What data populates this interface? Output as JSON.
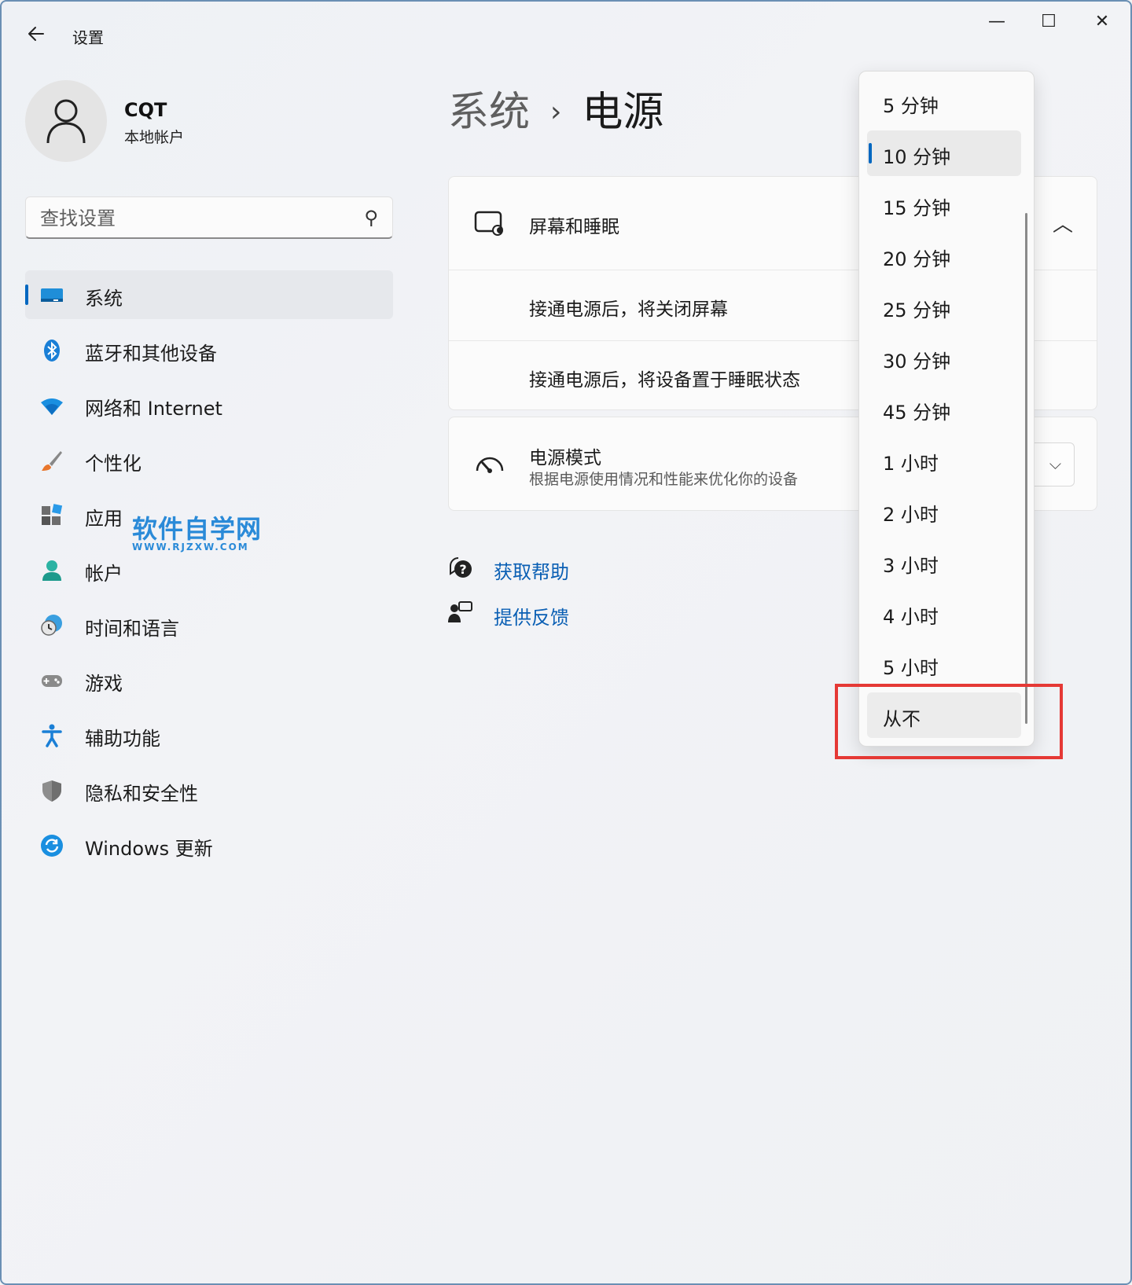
{
  "window": {
    "title": "设置",
    "back_icon": "arrow-left-icon",
    "min_glyph": "—",
    "max_glyph": "☐",
    "close_glyph": "✕"
  },
  "profile": {
    "name": "CQT",
    "account_type": "本地帐户"
  },
  "search": {
    "placeholder": "查找设置",
    "icon_glyph": "⚲"
  },
  "sidebar": {
    "items": [
      {
        "label": "系统",
        "icon": "system-icon",
        "active": true
      },
      {
        "label": "蓝牙和其他设备",
        "icon": "bluetooth-icon"
      },
      {
        "label": "网络和 Internet",
        "icon": "wifi-icon"
      },
      {
        "label": "个性化",
        "icon": "brush-icon"
      },
      {
        "label": "应用",
        "icon": "apps-icon"
      },
      {
        "label": "帐户",
        "icon": "account-icon"
      },
      {
        "label": "时间和语言",
        "icon": "clock-globe-icon"
      },
      {
        "label": "游戏",
        "icon": "gamepad-icon"
      },
      {
        "label": "辅助功能",
        "icon": "accessibility-icon"
      },
      {
        "label": "隐私和安全性",
        "icon": "shield-icon"
      },
      {
        "label": "Windows 更新",
        "icon": "update-icon"
      }
    ]
  },
  "watermark": {
    "main": "软件自学网",
    "sub": "WWW.RJZXW.COM"
  },
  "breadcrumb": {
    "parent": "系统",
    "separator": "›",
    "current": "电源"
  },
  "screen_sleep": {
    "title": "屏幕和睡眠",
    "row1": "接通电源后，将关闭屏幕",
    "row2": "接通电源后，将设备置于睡眠状态",
    "chevron": "︿"
  },
  "power_mode": {
    "title": "电源模式",
    "description": "根据电源使用情况和性能来优化你的设备",
    "chevron": "⌵"
  },
  "links": {
    "help": "获取帮助",
    "feedback": "提供反馈"
  },
  "dropdown": {
    "selected_index": 1,
    "highlighted_index": 12,
    "options": [
      "5 分钟",
      "10 分钟",
      "15 分钟",
      "20 分钟",
      "25 分钟",
      "30 分钟",
      "45 分钟",
      "1 小时",
      "2 小时",
      "3 小时",
      "4 小时",
      "5 小时",
      "从不"
    ]
  },
  "colors": {
    "accent": "#0067c0",
    "highlight_box": "#e53935",
    "link": "#0a5fb4"
  }
}
